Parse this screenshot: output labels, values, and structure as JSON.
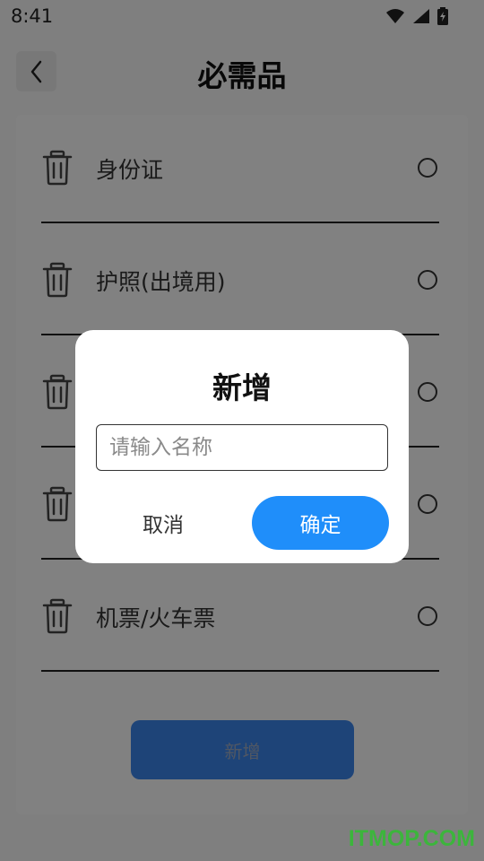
{
  "status_bar": {
    "time": "8:41",
    "icons": [
      "wifi-icon",
      "signal-icon",
      "battery-icon"
    ]
  },
  "header": {
    "title": "必需品",
    "back_icon": "chevron-left-icon"
  },
  "items": [
    {
      "label": "身份证",
      "icon": "trash-icon"
    },
    {
      "label": "护照(出境用)",
      "icon": "trash-icon"
    },
    {
      "label": "",
      "icon": "trash-icon"
    },
    {
      "label": "",
      "icon": "trash-icon"
    },
    {
      "label": "机票/火车票",
      "icon": "trash-icon"
    }
  ],
  "add_button_label": "新增",
  "dialog": {
    "title": "新增",
    "input_placeholder": "请输入名称",
    "cancel_label": "取消",
    "confirm_label": "确定"
  },
  "watermark": "ITMOP.COM",
  "colors": {
    "primary": "#1f8efa",
    "overlay": "#000000",
    "watermark": "#3cb53c"
  }
}
